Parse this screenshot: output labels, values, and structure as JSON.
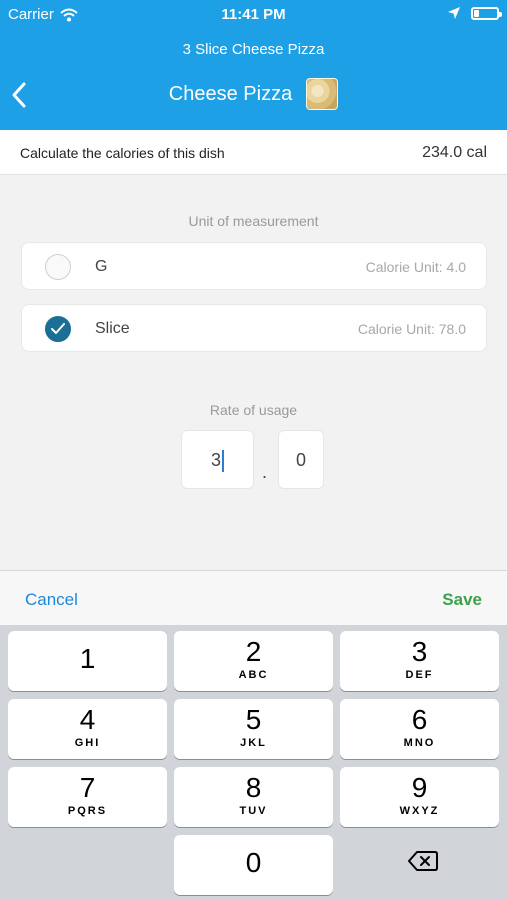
{
  "status_bar": {
    "carrier": "Carrier",
    "time": "11:41 PM"
  },
  "header": {
    "subtitle": "3 Slice Cheese Pizza",
    "title": "Cheese Pizza"
  },
  "calories": {
    "label": "Calculate the calories of this dish",
    "value": "234.0 cal"
  },
  "unit_section": {
    "title": "Unit of measurement",
    "options": [
      {
        "name": "G",
        "unit": "Calorie Unit: 4.0",
        "selected": false
      },
      {
        "name": "Slice",
        "unit": "Calorie Unit: 78.0",
        "selected": true
      }
    ]
  },
  "rate_section": {
    "title": "Rate of usage",
    "whole": "3",
    "separator": ".",
    "fraction": "0"
  },
  "actions": {
    "cancel": "Cancel",
    "save": "Save"
  },
  "keyboard": {
    "keys": [
      {
        "num": "1",
        "letters": ""
      },
      {
        "num": "2",
        "letters": "ABC"
      },
      {
        "num": "3",
        "letters": "DEF"
      },
      {
        "num": "4",
        "letters": "GHI"
      },
      {
        "num": "5",
        "letters": "JKL"
      },
      {
        "num": "6",
        "letters": "MNO"
      },
      {
        "num": "7",
        "letters": "PQRS"
      },
      {
        "num": "8",
        "letters": "TUV"
      },
      {
        "num": "9",
        "letters": "WXYZ"
      },
      {
        "num": "0",
        "letters": ""
      }
    ]
  },
  "icons": {
    "wifi": "wifi-icon",
    "location": "location-arrow-icon",
    "battery": "battery-icon",
    "back": "chevron-left-icon",
    "check": "checkmark-icon",
    "backspace": "backspace-icon"
  },
  "colors": {
    "header": "#1ea0e6",
    "radio_selected": "#1b6f95",
    "cancel": "#1e88d8",
    "save": "#3ca24a"
  }
}
